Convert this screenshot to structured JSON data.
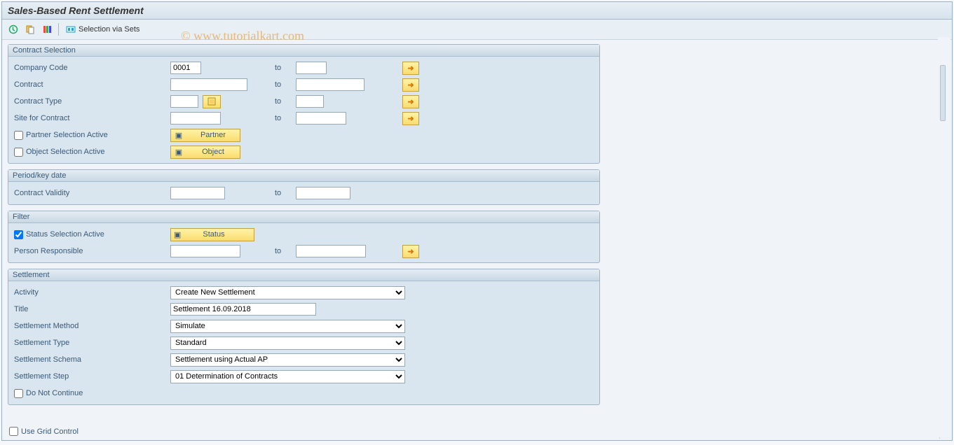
{
  "title": "Sales-Based Rent Settlement",
  "toolbar": {
    "selection_via_sets": "Selection via Sets"
  },
  "watermark": "©  www.tutorialkart.com",
  "groups": {
    "contract_selection": {
      "title": "Contract Selection",
      "company_code": {
        "label": "Company Code",
        "from": "0001",
        "to_label": "to",
        "to": ""
      },
      "contract": {
        "label": "Contract",
        "from": "",
        "to_label": "to",
        "to": ""
      },
      "contract_type": {
        "label": "Contract Type",
        "from": "",
        "to_label": "to",
        "to": ""
      },
      "site": {
        "label": "Site for Contract",
        "from": "",
        "to_label": "to",
        "to": ""
      },
      "partner_active": {
        "label": "Partner Selection Active",
        "checked": false,
        "btn": "Partner"
      },
      "object_active": {
        "label": "Object Selection Active",
        "checked": false,
        "btn": "Object"
      }
    },
    "period": {
      "title": "Period/key date",
      "validity": {
        "label": "Contract Validity",
        "from": "",
        "to_label": "to",
        "to": ""
      }
    },
    "filter": {
      "title": "Filter",
      "status_active": {
        "label": "Status Selection Active",
        "checked": true,
        "btn": "Status"
      },
      "person": {
        "label": "Person Responsible",
        "from": "",
        "to_label": "to",
        "to": ""
      }
    },
    "settlement": {
      "title": "Settlement",
      "activity": {
        "label": "Activity",
        "value": "Create New Settlement"
      },
      "title_field": {
        "label": "Title",
        "value": "Settlement 16.09.2018"
      },
      "method": {
        "label": "Settlement Method",
        "value": "Simulate"
      },
      "type": {
        "label": "Settlement Type",
        "value": "Standard"
      },
      "schema": {
        "label": "Settlement Schema",
        "value": "Settlement using Actual AP"
      },
      "step": {
        "label": "Settlement Step",
        "value": "01 Determination of Contracts"
      },
      "do_not_continue": {
        "label": "Do Not Continue",
        "checked": false
      }
    }
  },
  "footer": {
    "use_grid": "Use Grid Control"
  }
}
